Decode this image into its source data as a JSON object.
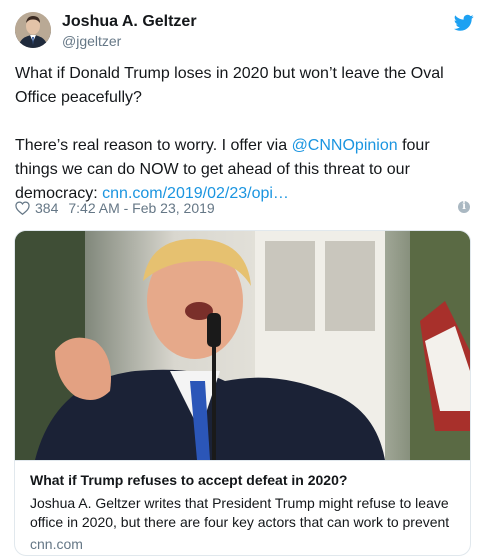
{
  "author": {
    "name": "Joshua A. Geltzer",
    "handle": "@jgeltzer"
  },
  "tweet": {
    "line1": "What if Donald Trump loses in 2020 but won’t leave the Oval Office peacefully?",
    "line2_before": "There’s real reason to worry. I offer via ",
    "mention": "@CNNOpinion",
    "line2_after": " four things we can do NOW to get ahead of this threat to our democracy: ",
    "url": "cnn.com/2019/02/23/opi…"
  },
  "meta": {
    "likes": "384",
    "timestamp": "7:42 AM - Feb 23, 2019"
  },
  "card": {
    "title": "What if Trump refuses to accept defeat in 2020?",
    "description": "Joshua A. Geltzer writes that President Trump might refuse to leave office in 2020, but there are four key actors that can work to prevent",
    "domain": "cnn.com"
  },
  "icons": {
    "bird": "twitter-bird-icon",
    "heart": "heart-icon",
    "info": "info-icon"
  },
  "colors": {
    "link": "#1b95e0",
    "secondary": "#657786",
    "border": "#e1e8ed",
    "bird": "#1da1f2"
  }
}
